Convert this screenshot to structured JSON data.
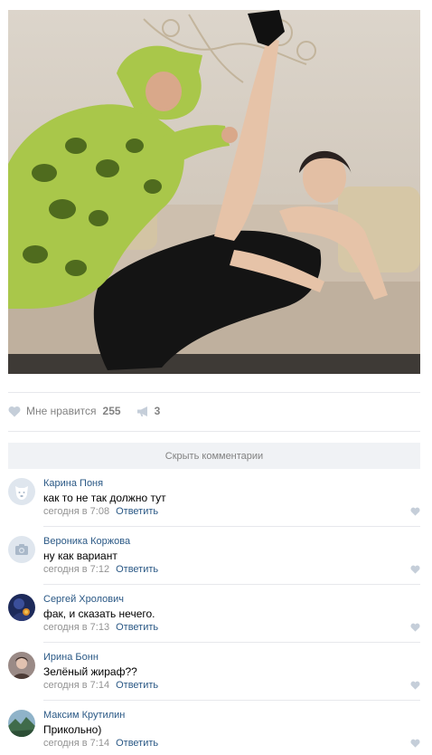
{
  "post": {
    "photo_icon": "photo-illustration",
    "like_label": "Мне нравится",
    "like_count": "255",
    "share_count": "3"
  },
  "comments_bar": {
    "hide_label": "Скрыть комментарии"
  },
  "comments": [
    {
      "author": "Карина Поня",
      "text": "как то не так должно тут",
      "time": "сегодня в 7:08",
      "reply": "Ответить",
      "avatar": "default-dog-avatar"
    },
    {
      "author": "Вероника Коржова",
      "text": "ну как вариант",
      "time": "сегодня в 7:12",
      "reply": "Ответить",
      "avatar": "camera-avatar"
    },
    {
      "author": "Сергей Хролович",
      "text": "фак, и сказать нечего.",
      "time": "сегодня в 7:13",
      "reply": "Ответить",
      "avatar": "photo-avatar"
    },
    {
      "author": "Ирина Бонн",
      "text": "Зелёный жираф??",
      "time": "сегодня в 7:14",
      "reply": "Ответить",
      "avatar": "photo-avatar"
    },
    {
      "author": "Максим Крутилин",
      "text": "Прикольно)",
      "time": "сегодня в 7:14",
      "reply": "Ответить",
      "avatar": "landscape-avatar"
    }
  ],
  "colors": {
    "link": "#2a5885",
    "muted": "#828282",
    "bar_bg": "#f0f2f5",
    "divider": "#e7e8ec"
  }
}
